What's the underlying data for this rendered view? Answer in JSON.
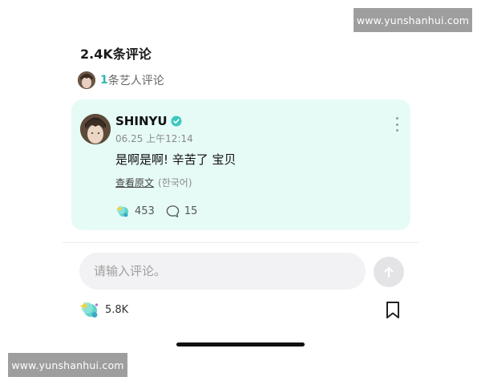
{
  "watermarks": {
    "top": "www.yunshanhui.com",
    "bottom": "www.yunshanhui.com"
  },
  "header": {
    "comment_count_title": "2.4K条评论",
    "artist_comment_count": "1",
    "artist_comment_label": "条艺人评论"
  },
  "comment": {
    "author": "SHINYU",
    "verified_icon": "verified-check-icon",
    "timestamp": "06.25 上午12:14",
    "text": "是啊是啊! 辛苦了 宝贝",
    "translate_label": "查看原文",
    "language": "(한국어)",
    "like_count": "453",
    "reply_count": "15",
    "more_icon": "more-vertical-icon"
  },
  "composer": {
    "placeholder": "请输入评论。",
    "send_icon": "arrow-up-icon"
  },
  "footer": {
    "like_total": "5.8K",
    "bookmark_icon": "bookmark-icon"
  },
  "colors": {
    "card_bg": "#e6fbf6",
    "accent": "#2fb8b0",
    "verified": "#3fc6c0"
  }
}
